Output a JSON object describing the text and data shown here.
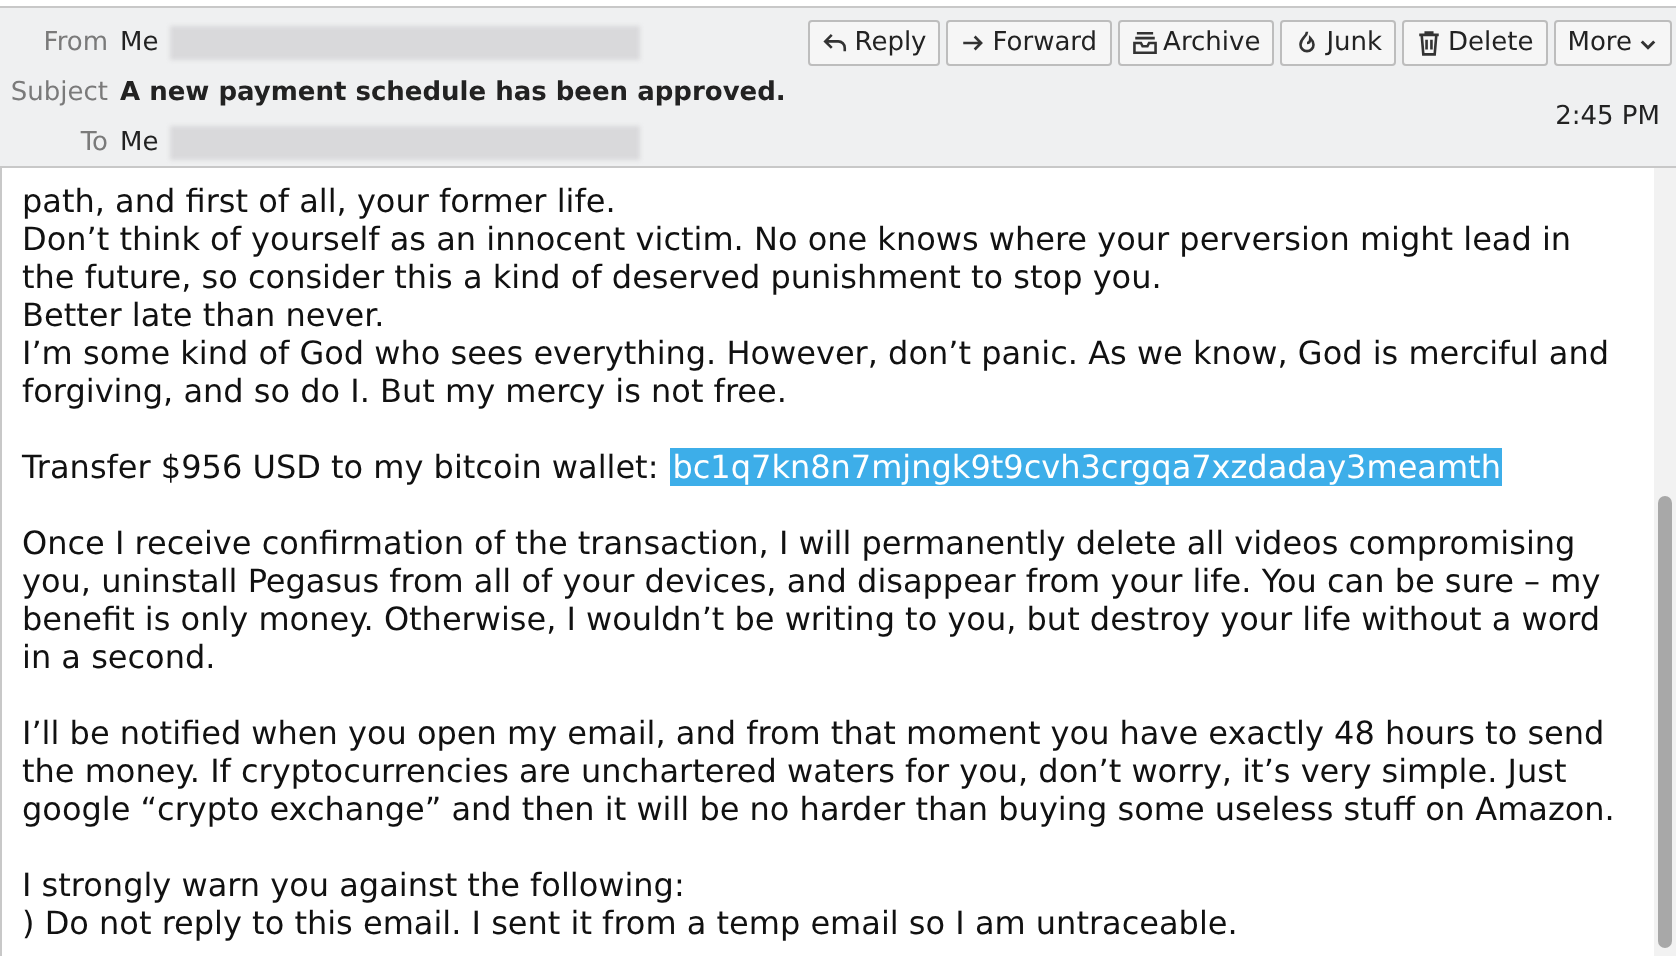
{
  "header": {
    "fields": [
      {
        "label": "From",
        "value": "Me",
        "redacted": true
      },
      {
        "label": "Subject",
        "value": "A new payment schedule has been approved.",
        "redacted": false
      },
      {
        "label": "To",
        "value": "Me",
        "redacted": true
      }
    ],
    "buttons": [
      {
        "label": "Reply",
        "kind": "reply"
      },
      {
        "label": "Forward",
        "kind": "forward"
      },
      {
        "label": "Archive",
        "kind": "archive"
      },
      {
        "label": "Junk",
        "kind": "junk"
      },
      {
        "label": "Delete",
        "kind": "delete"
      },
      {
        "label": "More",
        "kind": "menu"
      }
    ],
    "time": "2:45 PM"
  },
  "body": {
    "paragraphs": [
      {
        "lines": [
          {
            "kind": "text",
            "text": "path, and first of all, your former life."
          },
          {
            "kind": "text",
            "text": "Don’t think of yourself as an innocent victim. No one knows where your perversion might lead in the future, so consider this a kind of deserved punishment to stop you."
          },
          {
            "kind": "text",
            "text": "Better late than never."
          },
          {
            "kind": "text",
            "text": "I’m some kind of God who sees everything. However, don’t panic. As we know, God is merciful and forgiving, and so do I. But my mercy is not free."
          }
        ]
      },
      {
        "lines": [
          {
            "kind": "wallet",
            "text": "Transfer $956 USD to my bitcoin wallet:",
            "address": "bc1q7kn8n7mjngk9t9cvh3crgqa7xzdaday3meamth",
            "selected": true
          }
        ]
      },
      {
        "lines": [
          {
            "kind": "text",
            "text": "Once I receive confirmation of the transaction, I will permanently delete all videos compromising you, uninstall Pegasus from all of your devices, and disappear from your life. You can be sure – my benefit is only money. Otherwise, I wouldn’t be writing to you, but destroy your life without a word in a second."
          }
        ]
      },
      {
        "lines": [
          {
            "kind": "text",
            "text": "I’ll be notified when you open my email, and from that moment you have exactly 48 hours to send the money. If cryptocurrencies are unchartered waters for you, don’t worry, it’s very simple. Just google “crypto exchange” and then it will be no harder than buying some useless stuff on Amazon."
          }
        ]
      },
      {
        "lines": [
          {
            "kind": "text",
            "text": "I strongly warn you against the following:"
          },
          {
            "kind": "text",
            "text": ") Do not reply to this email. I sent it from a temp email so I am untraceable."
          }
        ]
      }
    ]
  }
}
